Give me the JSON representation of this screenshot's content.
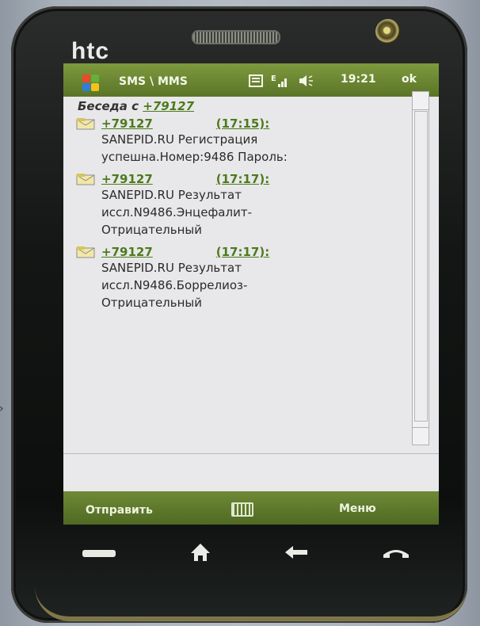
{
  "device": {
    "brand": "htc"
  },
  "status_bar": {
    "app_title": "SMS \\ MMS",
    "icons": [
      "windows-logo-icon",
      "message-icon",
      "signal-icon",
      "volume-icon"
    ],
    "time": "19:21",
    "ok_label": "ok"
  },
  "conversation": {
    "header_prefix": "Беседа с",
    "header_number": "+79127",
    "messages": [
      {
        "sender": "+79127",
        "time": "(17:15):",
        "text_line1": "SANEPID.RU Регистрация",
        "text_line2": "успешна.Номер:9486 Пароль:"
      },
      {
        "sender": "+79127",
        "time": "(17:17):",
        "text_line1": "SANEPID.RU Результат",
        "text_line2": "иссл.N9486.Энцефалит-",
        "text_line3": "Отрицательный"
      },
      {
        "sender": "+79127",
        "time": "(17:17):",
        "text_line1": "SANEPID.RU Результат",
        "text_line2": "иссл.N9486.Боррелиоз-",
        "text_line3": "Отрицательный"
      }
    ]
  },
  "softkeys": {
    "left": "Отправить",
    "right": "Меню"
  },
  "colors": {
    "bar_green": "#5a7427",
    "link_green": "#4d7a1c",
    "screen_bg": "#e8e8ea"
  }
}
